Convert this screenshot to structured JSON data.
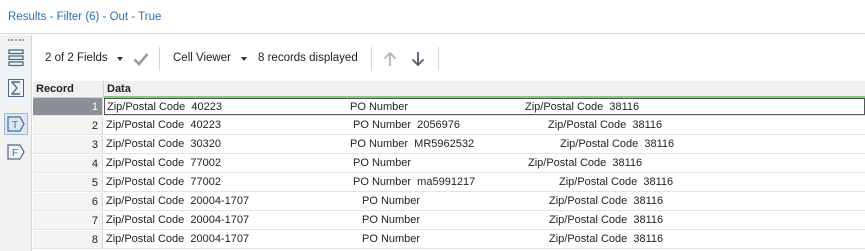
{
  "window": {
    "title": "Results - Filter (6) - Out - True"
  },
  "left_rail": {
    "buttons": [
      {
        "name": "table-view-icon",
        "active": false
      },
      {
        "name": "sum-icon",
        "active": false
      },
      {
        "name": "text-tag-icon",
        "active": true
      },
      {
        "name": "field-tag-icon",
        "active": false
      }
    ]
  },
  "toolbar": {
    "fields_label": "2 of 2 Fields",
    "viewer_label": "Cell Viewer",
    "records_label": "8 records displayed"
  },
  "grid": {
    "columns": [
      "Record",
      "Data"
    ],
    "rows": [
      {
        "record": "1",
        "c1": "Zip/Postal Code  40223",
        "c2": "PO Number",
        "c3": "Zip/Postal Code  38116"
      },
      {
        "record": "2",
        "c1": "Zip/Postal Code  40223",
        "c2": "PO Number  2056976",
        "c3": "Zip/Postal Code  38116"
      },
      {
        "record": "3",
        "c1": "Zip/Postal Code  30320",
        "c2": "PO Number  MR5962532",
        "c3": "Zip/Postal Code  38116"
      },
      {
        "record": "4",
        "c1": "Zip/Postal Code  77002",
        "c2": "PO Number",
        "c3": "Zip/Postal Code  38116"
      },
      {
        "record": "5",
        "c1": "Zip/Postal Code  77002",
        "c2": "PO Number  ma5991217",
        "c3": "Zip/Postal Code  38116"
      },
      {
        "record": "6",
        "c1": "Zip/Postal Code  20004-1707",
        "c2": "PO Number",
        "c3": "Zip/Postal Code  38116"
      },
      {
        "record": "7",
        "c1": "Zip/Postal Code  20004-1707",
        "c2": "PO Number",
        "c3": "Zip/Postal Code  38116"
      },
      {
        "record": "8",
        "c1": "Zip/Postal Code  20004-1707",
        "c2": "PO Number",
        "c3": "Zip/Postal Code  38116"
      }
    ]
  }
}
